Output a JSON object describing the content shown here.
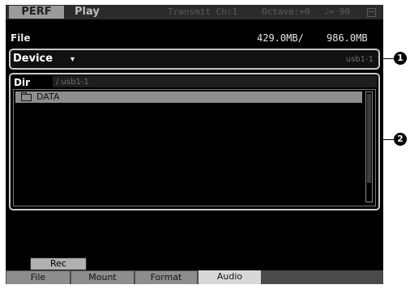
{
  "status_bar": {
    "mode": "PERF",
    "play_label": "Play",
    "transmit": "Transmit Ch:1",
    "octave": "Octave:+0",
    "tempo": "♩= 90"
  },
  "file_header": {
    "title": "File",
    "memory_used": "429.0MB/",
    "memory_total": "986.0MB"
  },
  "device": {
    "label": "Device",
    "dropdown_arrow": "▾",
    "value": "usb1-1"
  },
  "dir": {
    "label": "Dir",
    "path": "/ usb1-1",
    "items": [
      {
        "icon": "folder-icon",
        "name": "DATA",
        "selected": true
      }
    ]
  },
  "rec_button": {
    "label": "Rec"
  },
  "tabs": [
    {
      "label": "File",
      "active": false
    },
    {
      "label": "Mount",
      "active": false
    },
    {
      "label": "Format",
      "active": false
    },
    {
      "label": "Audio",
      "active": true
    }
  ],
  "callouts": {
    "device_callout": "1",
    "dir_callout": "2"
  }
}
